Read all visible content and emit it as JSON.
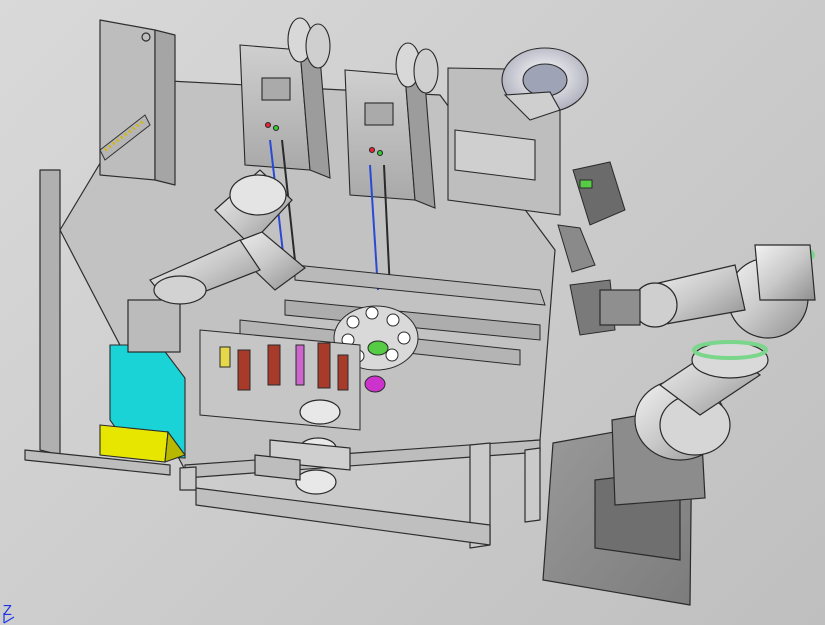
{
  "viewport": {
    "background_top": "#d9d9d9",
    "background_bottom": "#bfbfbf"
  },
  "colors": {
    "frame": "#c4c4c4",
    "frame_dark": "#8a8a8a",
    "panel": "#b8b8b8",
    "robot_gray": "#c9c9c9",
    "robot_accent": "#7ad68a",
    "bin_cyan": "#19d3d6",
    "bin_yellow": "#e6e600",
    "coil_red": "#a83a2a",
    "wheel_white": "#e8e8e8",
    "axis_blue": "#1a33e6",
    "magenta": "#cc33cc",
    "green_part": "#55cc44"
  },
  "triad": {
    "z_label": "Z",
    "icon": "coordinate-triad-icon"
  }
}
